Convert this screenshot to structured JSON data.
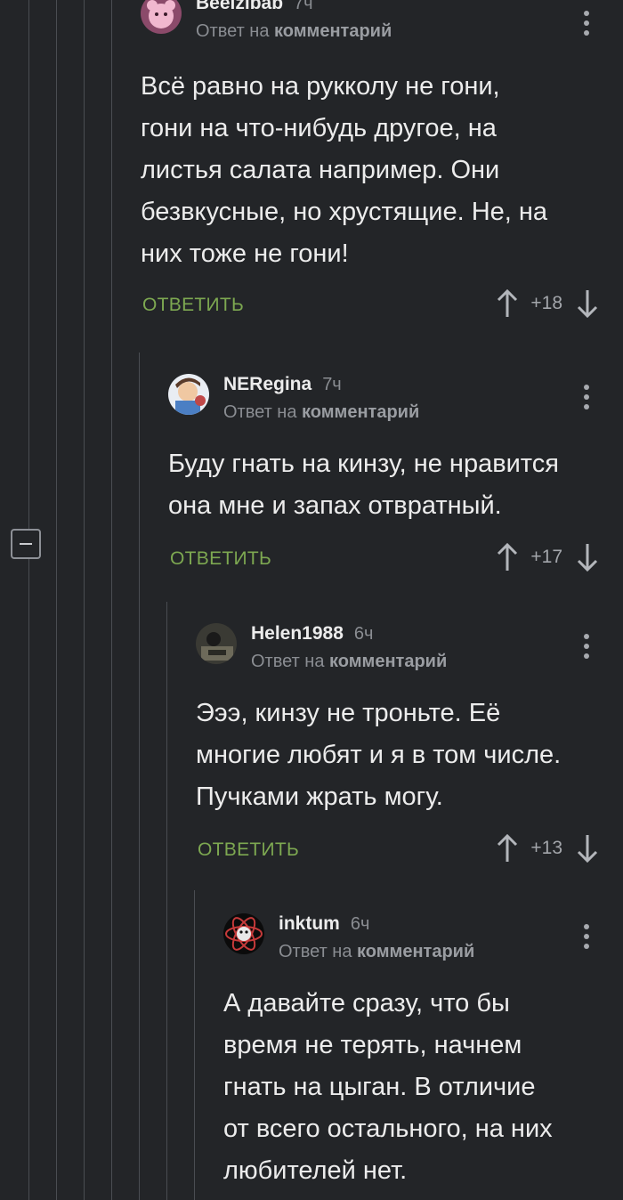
{
  "collapse_label": "−",
  "reply_on": "Ответ на",
  "reply_target": "комментарий",
  "reply_button": "ОТВЕТИТЬ",
  "colors": {
    "accent": "#7da851",
    "background": "#232528",
    "muted": "#8a8d92"
  },
  "comments": [
    {
      "username": "Beelzibab",
      "time": "7ч",
      "text": "Всё равно на рукколу не гони,\nгони на что-нибудь другое, на\nлистья салата например. Они\nбезвкусные, но хрустящие. Не, на\nних тоже не гони!",
      "rating": "+18"
    },
    {
      "username": "NERegina",
      "time": "7ч",
      "text": "Буду гнать на кинзу, не нравится\nона мне и запах отвратный.",
      "rating": "+17"
    },
    {
      "username": "Helen1988",
      "time": "6ч",
      "text": "Эээ, кинзу не троньте. Её\nмногие любят и я в том числе.\nПучками жрать могу.",
      "rating": "+13"
    },
    {
      "username": "inktum",
      "time": "6ч",
      "text": "А давайте сразу, что бы\nвремя не терять, начнем\nгнать на цыган. В отличие\nот всего остального, на них\nлюбителей нет."
    }
  ]
}
